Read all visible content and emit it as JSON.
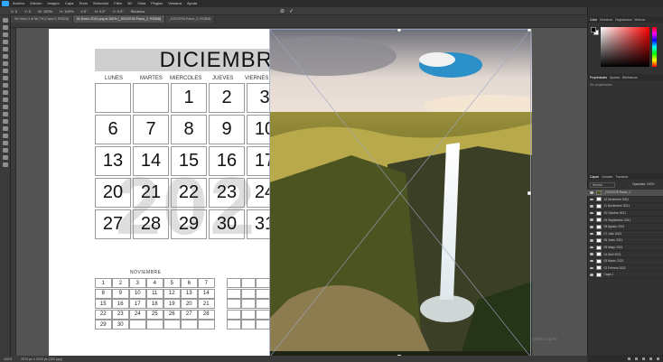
{
  "menu": [
    "Archivo",
    "Edición",
    "Imagen",
    "Capa",
    "Texto",
    "Selección",
    "Filtro",
    "3D",
    "Vista",
    "Plugins",
    "Ventana",
    "Ayuda"
  ],
  "options": [
    "X: 0",
    "Y: 0",
    "W: 100%",
    "H: 100%",
    "0.0°",
    "H: 0.0°",
    "V: 0.0°",
    "Bicúbica"
  ],
  "tabs": [
    {
      "label": "Sin título-3 al 66,7% (Capa 0, RGB/8)",
      "active": false
    },
    {
      "label": "01 Enero 2021.png al 100% (_DSC0078-Panor_2, RGB/8)",
      "active": true
    },
    {
      "label": "_DSC0078-Panor_2, RGB/8)",
      "active": false
    }
  ],
  "calendar": {
    "month": "DICIEMBRE",
    "watermark": "202",
    "days": [
      "LUNES",
      "MARTES",
      "MIERCOLES",
      "JUEVES",
      "VIERNES"
    ],
    "rows": [
      [
        "",
        "",
        "1",
        "2",
        "3"
      ],
      [
        "6",
        "7",
        "8",
        "9",
        "10"
      ],
      [
        "13",
        "14",
        "15",
        "16",
        "17"
      ],
      [
        "20",
        "21",
        "22",
        "23",
        "24"
      ],
      [
        "27",
        "28",
        "29",
        "30",
        "31"
      ]
    ],
    "mini_title": "NOVIEMBRE",
    "mini_rows": [
      [
        "1",
        "2",
        "3",
        "4",
        "5",
        "6",
        "7"
      ],
      [
        "8",
        "9",
        "10",
        "11",
        "12",
        "13",
        "14"
      ],
      [
        "15",
        "16",
        "17",
        "18",
        "19",
        "20",
        "21"
      ],
      [
        "22",
        "23",
        "24",
        "25",
        "26",
        "27",
        "28"
      ],
      [
        "29",
        "30",
        "",
        "",
        "",
        "",
        ""
      ]
    ],
    "website": "www.crearmiweb.org.es"
  },
  "status": {
    "zoom": "100%",
    "doc": "2970 px x 2100 px (300 ppp)"
  },
  "right_panel": {
    "color_tabs": [
      "Color",
      "Muestras",
      "Degradados",
      "Motivos"
    ],
    "prop_tabs": [
      "Propiedades",
      "Ajustes",
      "Bibliotecas"
    ],
    "prop_text": "Sin propiedades",
    "layer_tabs": [
      "Capas",
      "Canales",
      "Trazados"
    ],
    "blend_mode": "Normal",
    "opacity": "Opacidad: 100%",
    "layers": [
      {
        "name": "_DSC0078-Panor_2",
        "selected": true
      },
      {
        "name": "12 Diciembre 2021",
        "selected": false
      },
      {
        "name": "11 Noviembre 2021",
        "selected": false
      },
      {
        "name": "10 Octubre 2021",
        "selected": false
      },
      {
        "name": "09 Septiembre 2021",
        "selected": false
      },
      {
        "name": "08 Agosto 2021",
        "selected": false
      },
      {
        "name": "07 Julio 2021",
        "selected": false
      },
      {
        "name": "06 Junio 2021",
        "selected": false
      },
      {
        "name": "05 Mayo 2021",
        "selected": false
      },
      {
        "name": "04 Abril 2021",
        "selected": false
      },
      {
        "name": "03 Marzo 2021",
        "selected": false
      },
      {
        "name": "02 Febrero 2021",
        "selected": false
      },
      {
        "name": "Capa 1",
        "selected": false
      }
    ]
  },
  "colors": {
    "accent": "#31a8ff",
    "fg": "#000000",
    "bg": "#ffffff"
  }
}
